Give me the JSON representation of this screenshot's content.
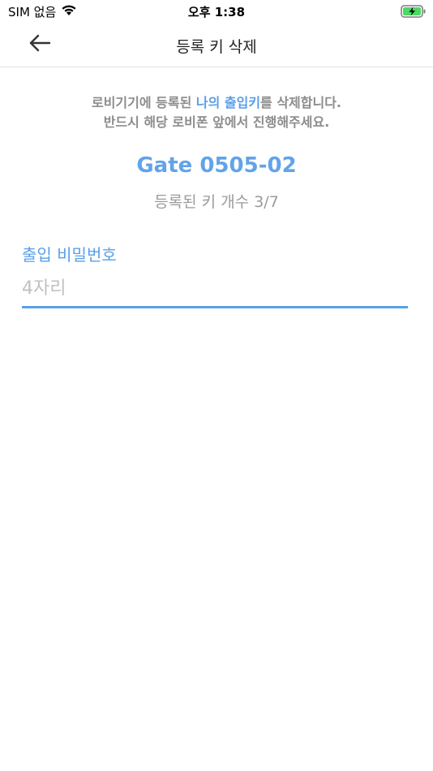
{
  "status_bar": {
    "carrier": "SIM 없음",
    "time": "오후 1:38"
  },
  "header": {
    "title": "등록 키 삭제"
  },
  "description": {
    "line1_prefix": "로비기기에 등록된 ",
    "line1_highlight": "나의 출입키",
    "line1_suffix": "를 삭제합니다.",
    "line2": "반드시 해당 로비폰 앞에서 진행해주세요."
  },
  "gate": {
    "name": "Gate 0505-02",
    "key_count": "등록된 키 개수 3/7"
  },
  "password_field": {
    "label": "출입 비밀번호",
    "placeholder": "4자리",
    "value": ""
  },
  "colors": {
    "accent": "#5a9fe8",
    "muted_text": "#8c8c8c"
  }
}
